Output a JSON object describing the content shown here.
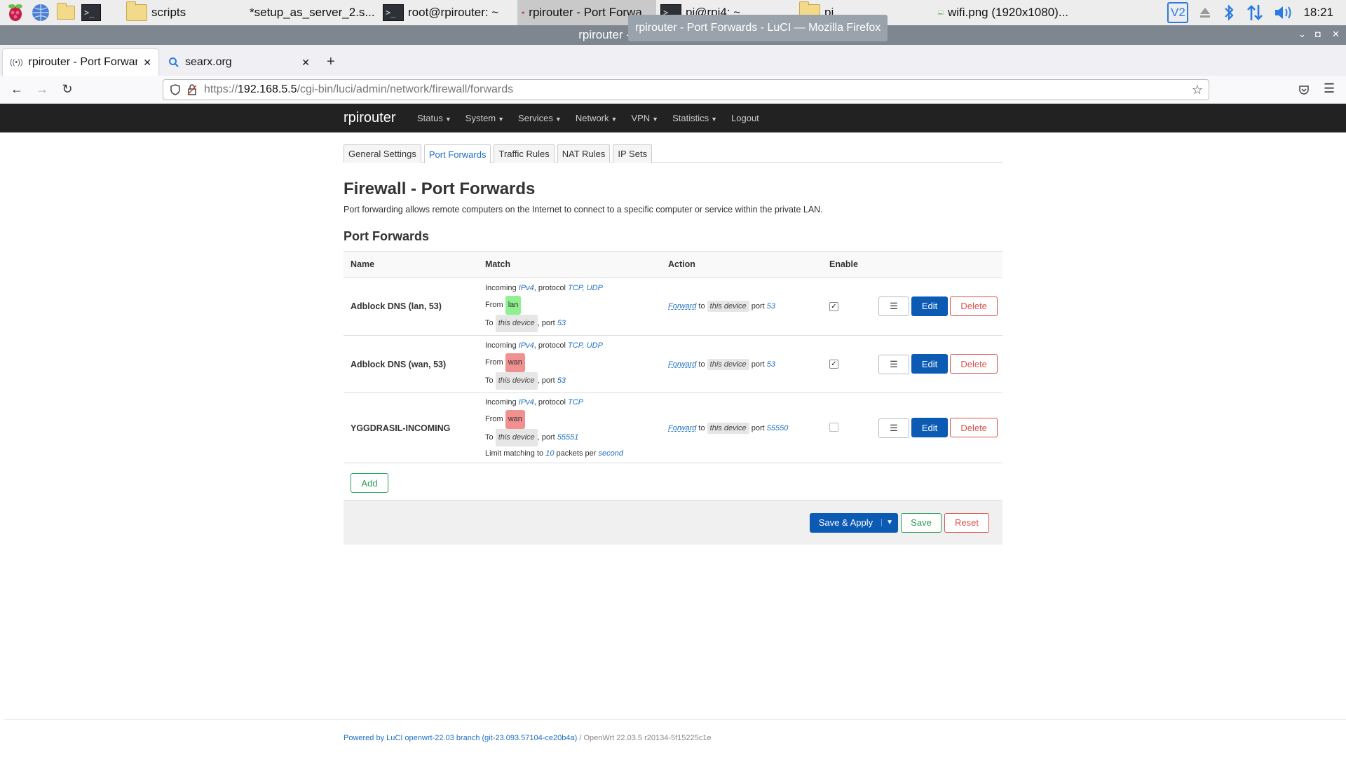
{
  "taskbar": {
    "tasks": [
      {
        "label": "scripts"
      },
      {
        "label": "*setup_as_server_2.s..."
      },
      {
        "label": "root@rpirouter: ~"
      },
      {
        "label": "rpirouter - Port Forwa..."
      },
      {
        "label": "pi@rpi4: ~"
      },
      {
        "label": "pi"
      },
      {
        "label": "wifi.png (1920x1080)..."
      }
    ],
    "clock": "18:21"
  },
  "firefox": {
    "window_title": "rpirouter - Port",
    "tooltip": "rpirouter - Port Forwards - LuCI — Mozilla Firefox",
    "tabs": [
      {
        "title": "rpirouter - Port Forwards"
      },
      {
        "title": "searx.org"
      }
    ],
    "url": {
      "proto": "https://",
      "host": "192.168.5.5",
      "path": "/cgi-bin/luci/admin/network/firewall/forwards"
    }
  },
  "luci": {
    "brand": "rpirouter",
    "menu": [
      "Status",
      "System",
      "Services",
      "Network",
      "VPN",
      "Statistics"
    ],
    "logout": "Logout"
  },
  "page": {
    "tabs": [
      "General Settings",
      "Port Forwards",
      "Traffic Rules",
      "NAT Rules",
      "IP Sets"
    ],
    "title": "Firewall - Port Forwards",
    "description": "Port forwarding allows remote computers on the Internet to connect to a specific computer or service within the private LAN.",
    "section_title": "Port Forwards",
    "columns": {
      "name": "Name",
      "match": "Match",
      "action": "Action",
      "enable": "Enable"
    },
    "rows": [
      {
        "name": "Adblock DNS (lan, 53)",
        "incoming": "Incoming",
        "family": "IPv4",
        "protocol_label": ", protocol",
        "protocols": "TCP, UDP",
        "from_label": "From",
        "from_zone": "lan",
        "to_label": "To",
        "to_device": "this device",
        "port_label": ", port",
        "to_port": "53",
        "limit_text": "",
        "action": "Forward",
        "action_to": "to",
        "action_device": "this device",
        "action_port_label": "port",
        "action_port": "53",
        "enabled": true
      },
      {
        "name": "Adblock DNS (wan, 53)",
        "incoming": "Incoming",
        "family": "IPv4",
        "protocol_label": ", protocol",
        "protocols": "TCP, UDP",
        "from_label": "From",
        "from_zone": "wan",
        "to_label": "To",
        "to_device": "this device",
        "port_label": ", port",
        "to_port": "53",
        "limit_text": "",
        "action": "Forward",
        "action_to": "to",
        "action_device": "this device",
        "action_port_label": "port",
        "action_port": "53",
        "enabled": true
      },
      {
        "name": "YGGDRASIL-INCOMING",
        "incoming": "Incoming",
        "family": "IPv4",
        "protocol_label": ", protocol",
        "protocols": "TCP",
        "from_label": "From",
        "from_zone": "wan",
        "to_label": "To",
        "to_device": "this device",
        "port_label": ", port",
        "to_port": "55551",
        "limit_prefix": "Limit matching to",
        "limit_count": "10",
        "limit_mid": "packets per",
        "limit_unit": "second",
        "action": "Forward",
        "action_to": "to",
        "action_device": "this device",
        "action_port_label": "port",
        "action_port": "55550",
        "enabled": false
      }
    ],
    "row_buttons": {
      "drag": "☰",
      "edit": "Edit",
      "delete": "Delete"
    },
    "add_label": "Add",
    "footer_buttons": {
      "save_apply": "Save & Apply",
      "save": "Save",
      "reset": "Reset"
    },
    "footer": {
      "powered": "Powered by LuCI openwrt-22.03 branch (git-23.093.57104-ce20b4a)",
      "version": " / OpenWrt 22.03.5 r20134-5f15225c1e"
    }
  },
  "colors": {
    "zone_lan": "#90f090",
    "zone_wan": "#f09090",
    "primary": "#0b5ab4",
    "header_bg": "#222222"
  }
}
